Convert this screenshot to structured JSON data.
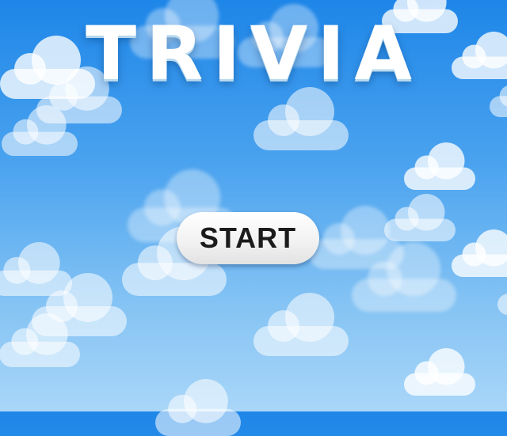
{
  "game": {
    "title": "TRIVIA",
    "start_label": "START"
  },
  "colors": {
    "sky_top": "#1e86e8",
    "sky_bottom": "#a9d6f8",
    "cloud": "#ffffff",
    "button_text": "#1b1b1b"
  },
  "icons": {
    "background": "cloud-icon"
  }
}
